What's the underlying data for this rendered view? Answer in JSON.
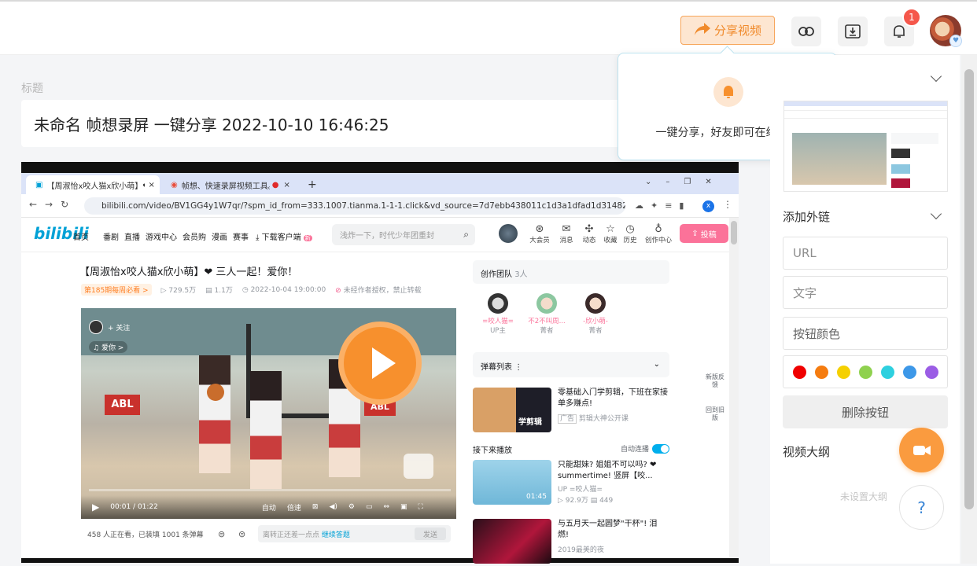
{
  "topbar": {
    "share_label": "分享视频",
    "notification_count": "1"
  },
  "popover": {
    "close": "×",
    "text": "一键分享，好友即可在线观看"
  },
  "editor": {
    "title_label": "标题",
    "title_value": "未命名 帧想录屏 一键分享 2022-10-10 16:46:25"
  },
  "right_panel": {
    "add_link_label": "添加外链",
    "url_placeholder": "URL",
    "text_placeholder": "文字",
    "button_color_placeholder": "按钮颜色",
    "colors": [
      "#f00000",
      "#f57c10",
      "#f5d000",
      "#8fd14f",
      "#2ed0df",
      "#3d98e8",
      "#9b5de5"
    ],
    "delete_button": "删除按钮",
    "outline_label": "视频大纲",
    "outline_empty": "未设置大纲",
    "help": "?"
  },
  "browser": {
    "tabs": [
      {
        "label": "【周淑怡x咬人猫x欣小萌】❤ 三"
      },
      {
        "label": "帧想、快速录屏视频工具。/"
      }
    ],
    "new_tab": "+",
    "url": "bilibili.com/video/BV1GG4y1W7qr/?spm_id_from=333.1007.tianma.1-1-1.click&vd_source=7d7ebb438011c1d3a1dfad1d31482...",
    "profile_initial": "x"
  },
  "bili": {
    "logo": "bilibili",
    "nav": [
      "首页",
      "番剧",
      "直播",
      "游戏中心",
      "会员购",
      "漫画",
      "赛事",
      "下载客户端"
    ],
    "nav_badge": "新",
    "search_placeholder": "浅炸一下，时代少年团重封",
    "icons": [
      {
        "label": "大会员",
        "icon": "vip-icon"
      },
      {
        "label": "消息",
        "icon": "message-icon"
      },
      {
        "label": "动态",
        "icon": "dynamic-icon"
      },
      {
        "label": "收藏",
        "icon": "favorite-icon"
      },
      {
        "label": "历史",
        "icon": "history-icon"
      },
      {
        "label": "创作中心",
        "icon": "creator-icon"
      }
    ],
    "post_label": "投稿",
    "video_title": "【周淑怡x咬人猫x欣小萌】❤ 三人一起！爱你！",
    "tag": "第185期每周必看 >",
    "views": "729.5万",
    "danmaku_count": "1.1万",
    "publish_time": "2022-10-04 19:00:00",
    "no_repost": "未经作者授权，禁止转载",
    "follow": "+ 关注",
    "music": "爱你 >",
    "time_current": "00:01",
    "time_total": "01:22",
    "ctrl_auto": "自动",
    "ctrl_speed": "倍速",
    "watching": "458 人正在看，已装填 1001 条弹幕",
    "danmu_placeholder": "离转正还差一点点",
    "danmu_link": "继续答题",
    "send": "发送",
    "team_title": "创作团队",
    "team_count": "3人",
    "members": [
      {
        "name": "=咬人猫=",
        "role": "UP主"
      },
      {
        "name": "不2不叫周...",
        "role": "菁者"
      },
      {
        "name": "-欣小萌-",
        "role": "菁者"
      }
    ],
    "danmu_list": "弹幕列表",
    "ad": {
      "title": "零基础入门学剪辑，下班在家接单多赚点!",
      "badge": "广告",
      "source": "剪辑大神公开课",
      "thumb_text": "学剪辑"
    },
    "next_label": "接下来播放",
    "autoplay": "自动连播",
    "recs": [
      {
        "title": "只能甜妹? 姐姐不可以吗? ❤summertime! 竖屏【咬...",
        "author": "=咬人猫=",
        "views": "92.9万",
        "danmaku": "449",
        "duration": "01:45"
      },
      {
        "title": "与五月天一起圆梦\"干杯\"! 泪燃!",
        "sub": "2019最美的夜"
      }
    ],
    "side_new": "新版反馈",
    "side_old": "回到旧版"
  }
}
